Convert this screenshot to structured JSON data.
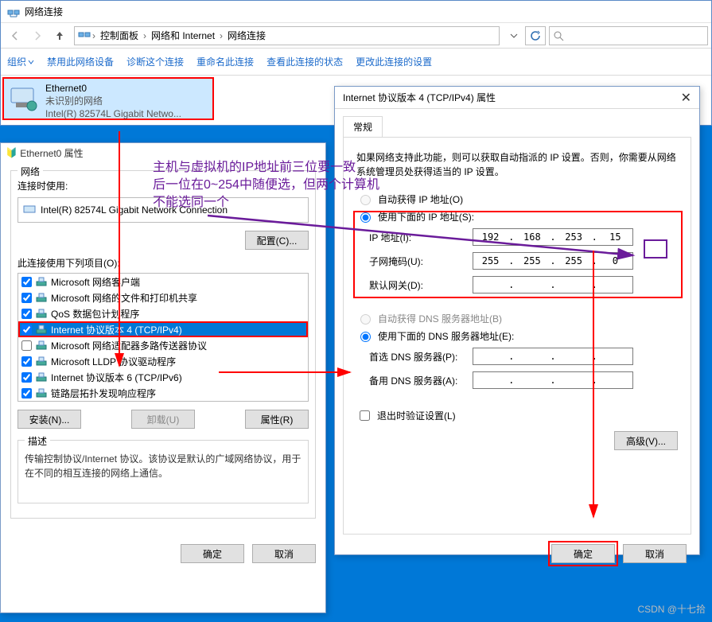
{
  "main_window": {
    "title": "网络连接",
    "breadcrumb": [
      "控制面板",
      "网络和 Internet",
      "网络连接"
    ],
    "search_placeholder": ""
  },
  "toolbar": {
    "organize": "组织",
    "disable": "禁用此网络设备",
    "diagnose": "诊断这个连接",
    "rename": "重命名此连接",
    "view_status": "查看此连接的状态",
    "change_settings": "更改此连接的设置"
  },
  "device": {
    "name": "Ethernet0",
    "status": "未识别的网络",
    "adapter": "Intel(R) 82574L Gigabit Netwo..."
  },
  "dialog1": {
    "title": "Ethernet0 属性",
    "tab_network": "网络",
    "connect_using": "连接时使用:",
    "adapter_full": "Intel(R) 82574L Gigabit Network Connection",
    "configure_btn": "配置(C)...",
    "items_label": "此连接使用下列项目(O):",
    "items": [
      {
        "checked": true,
        "label": "Microsoft 网络客户端",
        "icon": "client"
      },
      {
        "checked": true,
        "label": "Microsoft 网络的文件和打印机共享",
        "icon": "share"
      },
      {
        "checked": true,
        "label": "QoS 数据包计划程序",
        "icon": "qos"
      },
      {
        "checked": true,
        "label": "Internet 协议版本 4 (TCP/IPv4)",
        "icon": "proto",
        "selected": true,
        "redbox": true
      },
      {
        "checked": false,
        "label": "Microsoft 网络适配器多路传送器协议",
        "icon": "proto"
      },
      {
        "checked": true,
        "label": "Microsoft LLDP 协议驱动程序",
        "icon": "proto"
      },
      {
        "checked": true,
        "label": "Internet 协议版本 6 (TCP/IPv6)",
        "icon": "proto"
      },
      {
        "checked": true,
        "label": "链路层拓扑发现响应程序",
        "icon": "proto"
      }
    ],
    "install_btn": "安装(N)...",
    "uninstall_btn": "卸载(U)",
    "properties_btn": "属性(R)",
    "desc_label": "描述",
    "desc_text": "传输控制协议/Internet 协议。该协议是默认的广域网络协议，用于在不同的相互连接的网络上通信。",
    "ok": "确定",
    "cancel": "取消"
  },
  "dialog2": {
    "title": "Internet 协议版本 4 (TCP/IPv4) 属性",
    "tab_general": "常规",
    "info": "如果网络支持此功能，则可以获取自动指派的 IP 设置。否则，你需要从网络系统管理员处获得适当的 IP 设置。",
    "auto_ip": "自动获得 IP 地址(O)",
    "use_ip": "使用下面的 IP 地址(S):",
    "ip_label": "IP 地址(I):",
    "ip_value": [
      "192",
      "168",
      "253",
      "15"
    ],
    "mask_label": "子网掩码(U):",
    "mask_value": [
      "255",
      "255",
      "255",
      "0"
    ],
    "gateway_label": "默认网关(D):",
    "gateway_value": [
      "",
      "",
      "",
      ""
    ],
    "auto_dns": "自动获得 DNS 服务器地址(B)",
    "use_dns": "使用下面的 DNS 服务器地址(E):",
    "dns1_label": "首选 DNS 服务器(P):",
    "dns1_value": [
      "",
      "",
      "",
      ""
    ],
    "dns2_label": "备用 DNS 服务器(A):",
    "dns2_value": [
      "",
      "",
      "",
      ""
    ],
    "validate": "退出时验证设置(L)",
    "advanced": "高级(V)...",
    "ok": "确定",
    "cancel": "取消"
  },
  "annotation": {
    "line1": "主机与虚拟机的IP地址前三位要一致",
    "line2": "后一位在0~254中随便选，但两个计算机",
    "line3": "不能选同一个"
  },
  "watermark": "CSDN @十七拾"
}
